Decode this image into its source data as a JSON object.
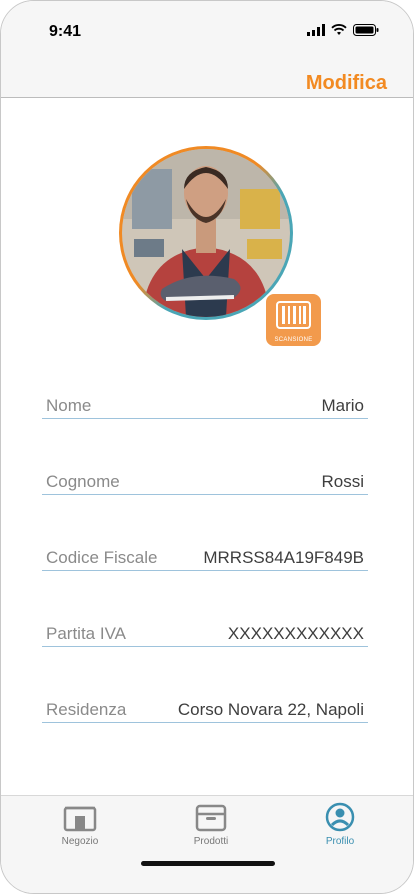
{
  "status_bar": {
    "time": "9:41"
  },
  "header": {
    "edit_label": "Modifica"
  },
  "profile": {
    "scan_label": "SCANSIONE"
  },
  "fields": [
    {
      "label": "Nome",
      "value": "Mario"
    },
    {
      "label": "Cognome",
      "value": "Rossi"
    },
    {
      "label": "Codice Fiscale",
      "value": "MRRSS84A19F849B"
    },
    {
      "label": "Partita IVA",
      "value": "XXXXXXXXXXXX"
    },
    {
      "label": "Residenza",
      "value": "Corso Novara 22, Napoli"
    }
  ],
  "tabbar": {
    "items": [
      {
        "label": "Negozio",
        "icon": "store-icon"
      },
      {
        "label": "Prodotti",
        "icon": "box-icon"
      },
      {
        "label": "Profilo",
        "icon": "user-circle-icon"
      }
    ],
    "active_index": 2
  },
  "colors": {
    "accent": "#f28a22",
    "active_tab": "#3a8fb0",
    "divider": "#9ec3dc"
  }
}
